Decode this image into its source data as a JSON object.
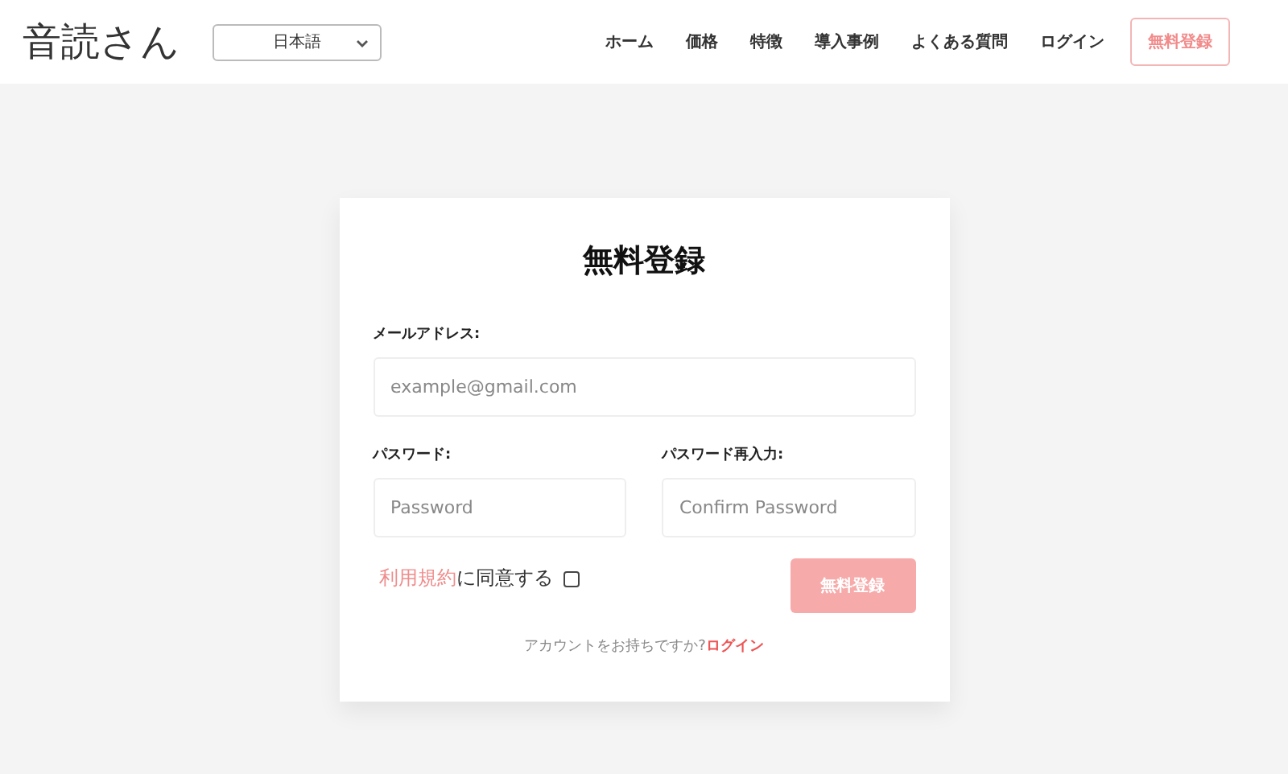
{
  "header": {
    "logo": "音読さん",
    "language_select": {
      "value": "日本語"
    },
    "nav": [
      {
        "label": "ホーム"
      },
      {
        "label": "価格"
      },
      {
        "label": "特徴"
      },
      {
        "label": "導入事例"
      },
      {
        "label": "よくある質問"
      },
      {
        "label": "ログイン"
      }
    ],
    "signup_button": "無料登録"
  },
  "form": {
    "title": "無料登録",
    "email": {
      "label": "メールアドレス:",
      "placeholder": "example@gmail.com"
    },
    "password": {
      "label": "パスワード:",
      "placeholder": "Password"
    },
    "confirm": {
      "label": "パスワード再入力:",
      "placeholder": "Confirm Password"
    },
    "terms": {
      "link": "利用規約",
      "text": "に同意する",
      "checked": false
    },
    "submit": {
      "label": "無料登録",
      "disabled": true
    },
    "footer": {
      "text": "アカウントをお持ちですか?",
      "link": "ログイン"
    }
  }
}
